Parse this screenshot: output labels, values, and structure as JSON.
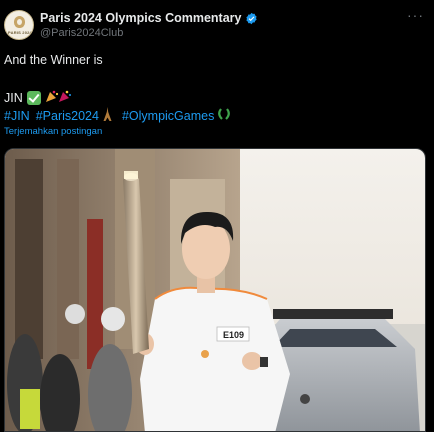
{
  "author": {
    "display_name": "Paris 2024 Olympics Commentary",
    "handle": "@Paris2024Club",
    "avatar_text": "PARIS 2024"
  },
  "tweet": {
    "line1": "And the Winner is",
    "line2_text": "JIN",
    "hashtags": [
      "#JIN",
      "#Paris2024",
      "#OlympicGames"
    ],
    "translate_label": "Terjemahkan postingan"
  },
  "media": {
    "bib_text": "E109"
  },
  "colors": {
    "background": "#000000",
    "text": "#e7e9ea",
    "secondary": "#71767b",
    "link": "#1d9bf0",
    "verified": "#1d9bf0"
  }
}
